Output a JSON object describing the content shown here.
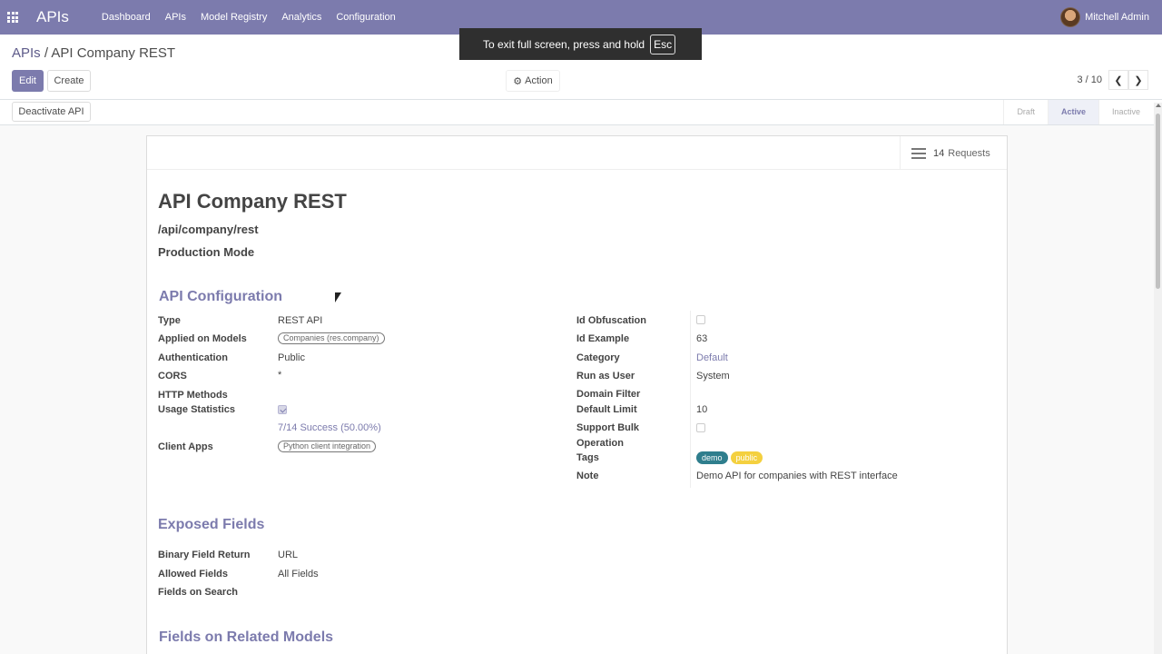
{
  "navbar": {
    "brand": "APIs",
    "menu": [
      "Dashboard",
      "APIs",
      "Model Registry",
      "Analytics",
      "Configuration"
    ],
    "user_name": "Mitchell Admin"
  },
  "toast": {
    "text": "To exit full screen, press and hold",
    "key": "Esc"
  },
  "breadcrumb": {
    "parent": "APIs",
    "separator": "/",
    "current": "API Company REST"
  },
  "toolbar": {
    "edit_label": "Edit",
    "create_label": "Create",
    "action_label": "Action"
  },
  "pager": {
    "value": "3 / 10"
  },
  "statusbar": {
    "deactivate_label": "Deactivate API",
    "stages": [
      "Draft",
      "Active",
      "Inactive"
    ],
    "active_stage": "Active"
  },
  "smart_button": {
    "count": "14",
    "label": "Requests"
  },
  "record": {
    "title": "API Company REST",
    "route": "/api/company/rest",
    "mode": "Production Mode"
  },
  "api_config": {
    "section_title": "API Configuration",
    "left": {
      "type_label": "Type",
      "type_value": "REST API",
      "models_label": "Applied on Models",
      "models_value": "Companies (res.company)",
      "auth_label": "Authentication",
      "auth_value": "Public",
      "cors_label": "CORS",
      "cors_value": "*",
      "http_label": "HTTP Methods",
      "usage_label": "Usage Statistics",
      "usage_checked": true,
      "success_text": "7/14 Success (50.00%)",
      "client_label": "Client Apps",
      "client_value": "Python client integration"
    },
    "right": {
      "idobf_label": "Id Obfuscation",
      "idobf_checked": false,
      "idex_label": "Id Example",
      "idex_value": "63",
      "category_label": "Category",
      "category_value": "Default",
      "runas_label": "Run as User",
      "runas_value": "System",
      "domain_label": "Domain Filter",
      "limit_label": "Default Limit",
      "limit_value": "10",
      "bulk_label_1": "Support Bulk",
      "bulk_label_2": "Operation",
      "bulk_checked": false,
      "tags_label": "Tags",
      "tags": [
        "demo",
        "public"
      ],
      "note_label": "Note",
      "note_value": "Demo API for companies with REST interface"
    }
  },
  "exposed_fields": {
    "section_title": "Exposed Fields",
    "binary_label": "Binary Field Return",
    "binary_value": "URL",
    "allowed_label": "Allowed Fields",
    "allowed_value": "All Fields",
    "search_label": "Fields on Search"
  },
  "related": {
    "section_title": "Fields on Related Models"
  },
  "colors": {
    "brand": "#7c7bad",
    "tag_demo": "#2f7e8d",
    "tag_public": "#f4d03f"
  }
}
